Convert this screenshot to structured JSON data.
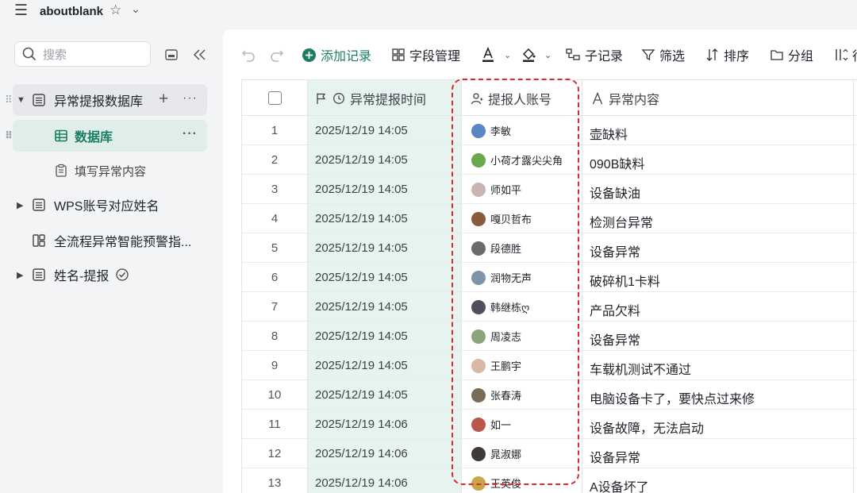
{
  "window": {
    "title": "aboutblank"
  },
  "sidebar": {
    "search_placeholder": "搜索",
    "items": [
      {
        "label": "异常提报数据库"
      },
      {
        "label": "数据库"
      },
      {
        "label": "填写异常内容"
      },
      {
        "label": "WPS账号对应姓名"
      },
      {
        "label": "全流程异常智能预警指..."
      },
      {
        "label": "姓名-提报"
      }
    ]
  },
  "toolbar": {
    "add_record": "添加记录",
    "field_manage": "字段管理",
    "sub_record": "子记录",
    "filter": "筛选",
    "sort": "排序",
    "group": "分组",
    "row_height_partial": "行"
  },
  "table": {
    "columns": [
      "异常提报时间",
      "提报人账号",
      "异常内容"
    ],
    "rows": [
      {
        "no": "1",
        "time": "2025/12/19 14:05",
        "user": "李敏",
        "content": "壶缺料"
      },
      {
        "no": "2",
        "time": "2025/12/19 14:05",
        "user": "小荷才露尖尖角",
        "content": "090B缺料"
      },
      {
        "no": "3",
        "time": "2025/12/19 14:05",
        "user": "师如平",
        "content": "设备缺油"
      },
      {
        "no": "4",
        "time": "2025/12/19 14:05",
        "user": "嘎贝哲布",
        "content": "检测台异常"
      },
      {
        "no": "5",
        "time": "2025/12/19 14:05",
        "user": "段德胜",
        "content": "设备异常"
      },
      {
        "no": "6",
        "time": "2025/12/19 14:05",
        "user": "润物无声",
        "content": "破碎机1卡料"
      },
      {
        "no": "7",
        "time": "2025/12/19 14:05",
        "user": "韩继栋ღ",
        "content": "产品欠料"
      },
      {
        "no": "8",
        "time": "2025/12/19 14:05",
        "user": "周凌志",
        "content": "设备异常"
      },
      {
        "no": "9",
        "time": "2025/12/19 14:05",
        "user": "王鹏宇",
        "content": "车载机测试不通过"
      },
      {
        "no": "10",
        "time": "2025/12/19 14:05",
        "user": "张春涛",
        "content": "电脑设备卡了，要快点过来修"
      },
      {
        "no": "11",
        "time": "2025/12/19 14:06",
        "user": "如一",
        "content": "设备故障，无法启动"
      },
      {
        "no": "12",
        "time": "2025/12/19 14:06",
        "user": "晁淑娜",
        "content": "设备异常"
      },
      {
        "no": "13",
        "time": "2025/12/19 14:06",
        "user": "王英俊",
        "content": "A设备坏了"
      }
    ]
  },
  "colors": {
    "accent": "#1b7d63",
    "time_column_bg": "#e6f3ef",
    "highlight": "#e0282e",
    "avatars": [
      "#5a86c6",
      "#6aa84f",
      "#c9b5b0",
      "#8a5a3c",
      "#6b6b6b",
      "#7f94a8",
      "#4f4f5f",
      "#8aa37c",
      "#d9b8a8",
      "#7a6b5a",
      "#b8584a",
      "#3f3a36",
      "#c9a54a"
    ]
  }
}
